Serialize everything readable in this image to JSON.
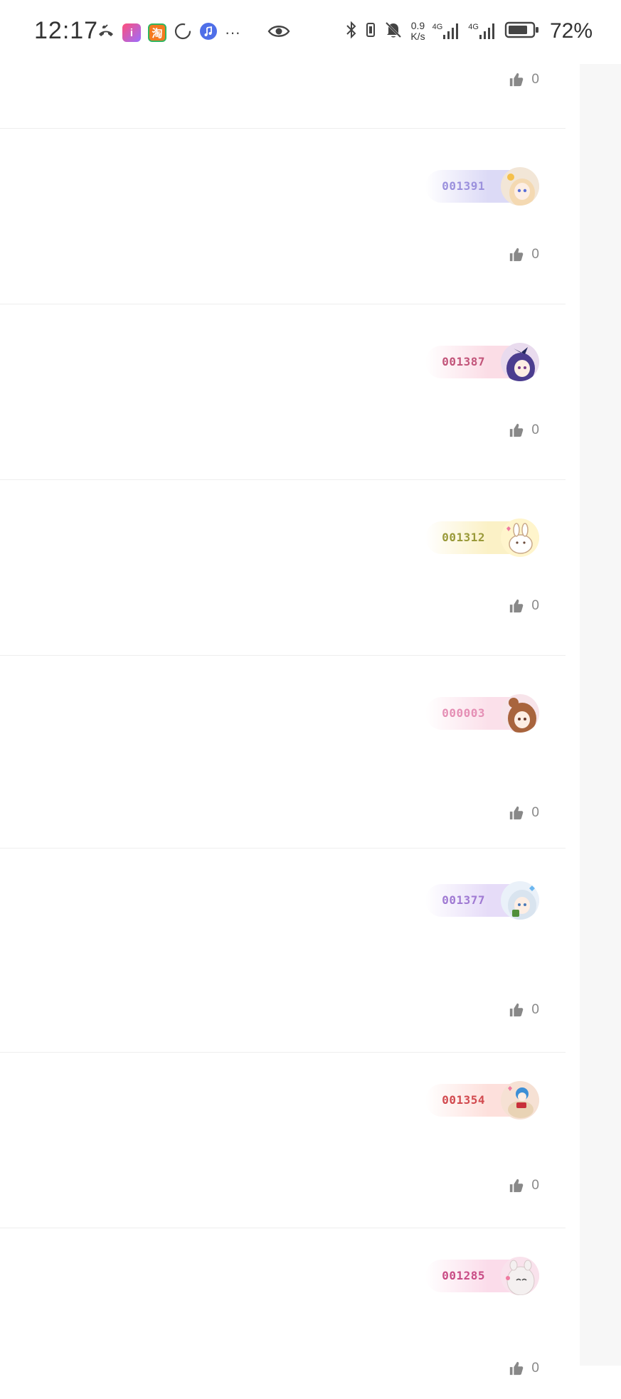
{
  "status_bar": {
    "time": "12:17",
    "net_speed_value": "0.9",
    "net_speed_unit": "K/s",
    "signal1_label": "4G",
    "signal2_label": "4G",
    "battery_percent": "72%",
    "taobao_glyph": "淘",
    "more_glyph": "···",
    "left_icons": [
      "missed-call-icon",
      "book-app-icon",
      "taobao-app-icon",
      "loading-circle-icon",
      "music-app-icon",
      "more-dots-icon",
      "eye-icon"
    ],
    "right_icons": [
      "bluetooth-icon",
      "vibrate-icon",
      "mute-bell-icon",
      "signal-icon",
      "signal-icon",
      "battery-icon"
    ]
  },
  "top_partial": {
    "like_count": "0"
  },
  "cards": [
    {
      "id": "001391",
      "like_count": "0",
      "color": "#9b91dd",
      "grad": "#dcdaf6",
      "avatar_bg": "#f2e6d7",
      "hair": "#f4d9b2"
    },
    {
      "id": "001387",
      "like_count": "0",
      "color": "#c2557a",
      "grad": "#fbdde6",
      "avatar_bg": "#e9dbee",
      "hair": "#4b3d8f"
    },
    {
      "id": "001312",
      "like_count": "0",
      "color": "#9a9a3a",
      "grad": "#fbf1c6",
      "avatar_bg": "#fff5cc",
      "hair": "#ffffff"
    },
    {
      "id": "000003",
      "like_count": "0",
      "color": "#e58fb5",
      "grad": "#fbe0ea",
      "avatar_bg": "#f7e4ea",
      "hair": "#a8643d"
    },
    {
      "id": "001377",
      "like_count": "0",
      "color": "#a07ad3",
      "grad": "#e6dcf8",
      "avatar_bg": "#eaf1f9",
      "hair": "#d9e4ef"
    },
    {
      "id": "001354",
      "like_count": "0",
      "color": "#d24a4f",
      "grad": "#fde0dc",
      "avatar_bg": "#f6e1d4",
      "hair": "#3c8fd6"
    },
    {
      "id": "001285",
      "like_count": "0",
      "color": "#c94c86",
      "grad": "#fbdcea",
      "avatar_bg": "#f9e2ec",
      "hair": "#f4f0f0"
    }
  ]
}
